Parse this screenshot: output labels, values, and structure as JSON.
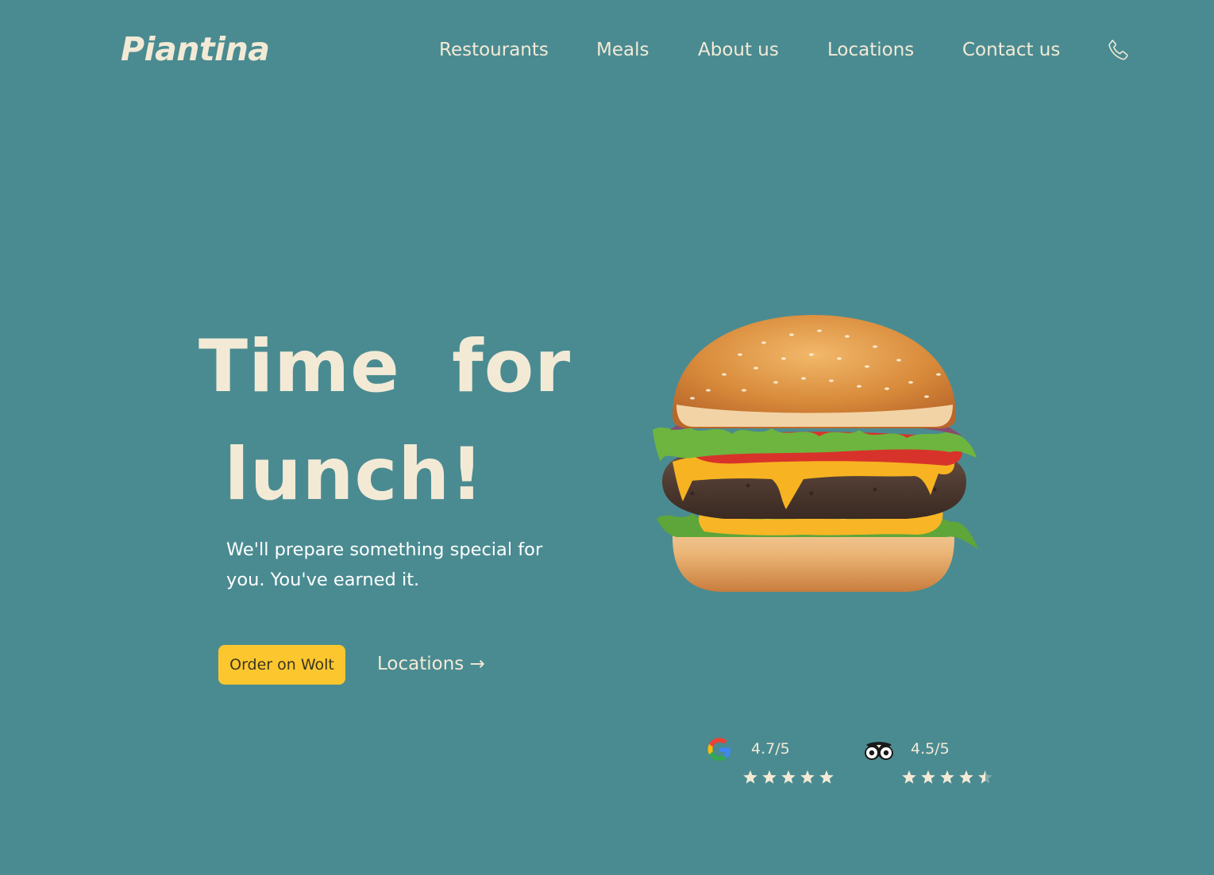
{
  "brand": {
    "logo_text": "Piantina"
  },
  "nav": {
    "items": [
      {
        "label": "Restourants"
      },
      {
        "label": "Meals"
      },
      {
        "label": "About us"
      },
      {
        "label": "Locations"
      },
      {
        "label": "Contact us"
      }
    ],
    "phone_icon": "phone-icon"
  },
  "hero": {
    "title": "Time  for\n lunch!",
    "subtitle": "We'll prepare something special for you. You've earned it.",
    "order_button_label": "Order on Wolt",
    "locations_link_label": "Locations →",
    "image": "burger-image"
  },
  "ratings": [
    {
      "source_icon": "google-icon",
      "score_text": "4.7/5",
      "stars": 5
    },
    {
      "source_icon": "tripadvisor-icon",
      "score_text": "4.5/5",
      "stars": 4.5
    }
  ],
  "colors": {
    "background": "#4a8b91",
    "text_cream": "#f3ead6",
    "button_yellow": "#fcc72e",
    "star_color": "#f3ead6"
  }
}
